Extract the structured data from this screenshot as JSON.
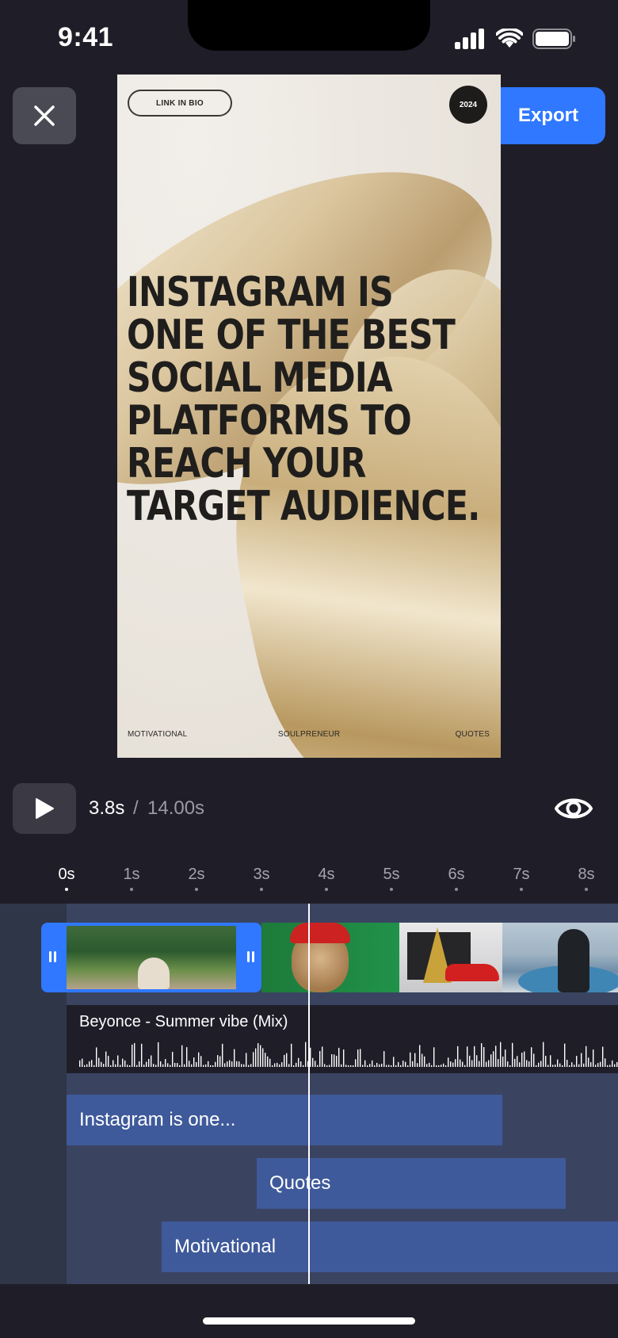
{
  "status": {
    "time": "9:41"
  },
  "header": {
    "export_label": "Export"
  },
  "preview": {
    "link_pill": "LINK IN BIO",
    "year_badge": "2024",
    "headline_lines": [
      "INSTAGRAM IS",
      "ONE OF THE BEST",
      "SOCIAL MEDIA",
      "PLATFORMS TO",
      "REACH YOUR",
      "TARGET AUDIENCE."
    ],
    "footer_left": "MOTIVATIONAL",
    "footer_center": "SOULPRENEUR",
    "footer_right": "QUOTES"
  },
  "playback": {
    "current": "3.8s",
    "separator": "/",
    "total": "14.00s"
  },
  "ruler": {
    "ticks": [
      "0s",
      "1s",
      "2s",
      "3s",
      "4s",
      "5s",
      "6s",
      "7s",
      "8s"
    ],
    "active_index": 0
  },
  "timeline": {
    "audio_title": "Beyonce - Summer vibe (Mix)",
    "text_clips": [
      "Instagram is one...",
      "Quotes",
      "Motivational"
    ]
  },
  "colors": {
    "accent": "#2f78ff",
    "background": "#1f1e28",
    "text_clip": "#3f5a9a"
  }
}
